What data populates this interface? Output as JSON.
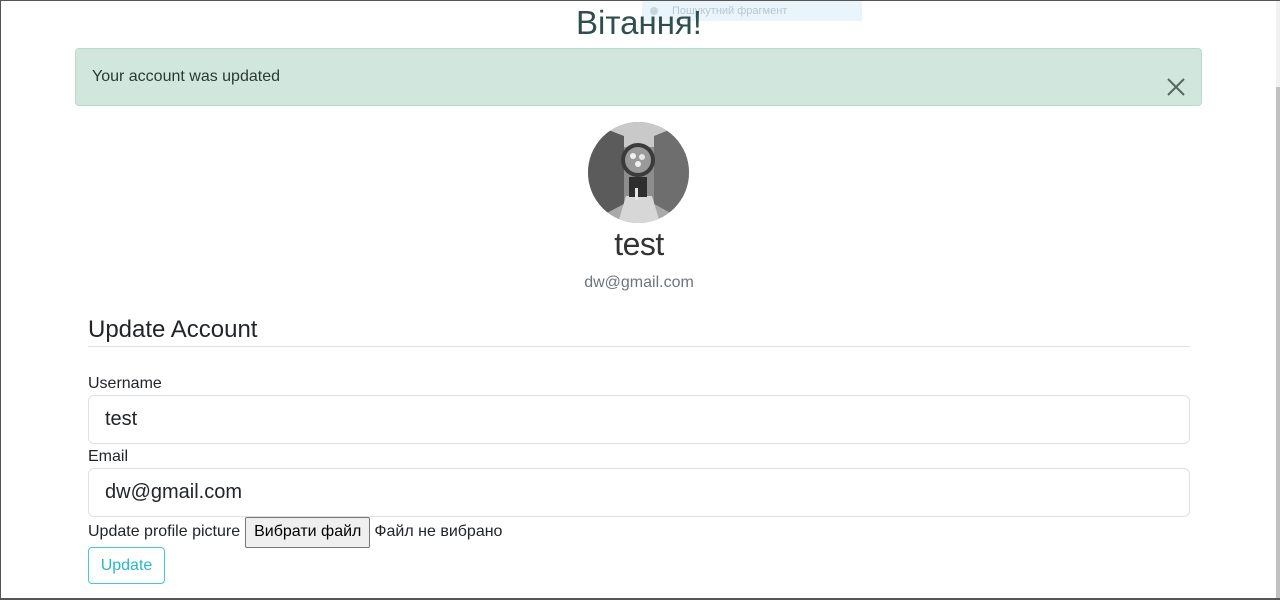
{
  "tooltip": {
    "text": "Пошукутний фрагмент"
  },
  "header": {
    "title": "Вітання!"
  },
  "alert": {
    "message": "Your account was updated",
    "close_icon": "close-icon"
  },
  "profile": {
    "avatar_icon": "avatar-image",
    "username": "test",
    "email": "dw@gmail.com"
  },
  "form": {
    "section_title": "Update Account",
    "username_label": "Username",
    "username_value": "test",
    "email_label": "Email",
    "email_value": "dw@gmail.com",
    "picture_label": "Update profile picture",
    "file_button_label": "Вибрати файл",
    "file_status": "Файл не вибрано",
    "submit_label": "Update"
  },
  "colors": {
    "alert_background": "#d1e7dd",
    "title_color": "#2f4f4f",
    "update_button_accent": "#3ec9e0"
  }
}
